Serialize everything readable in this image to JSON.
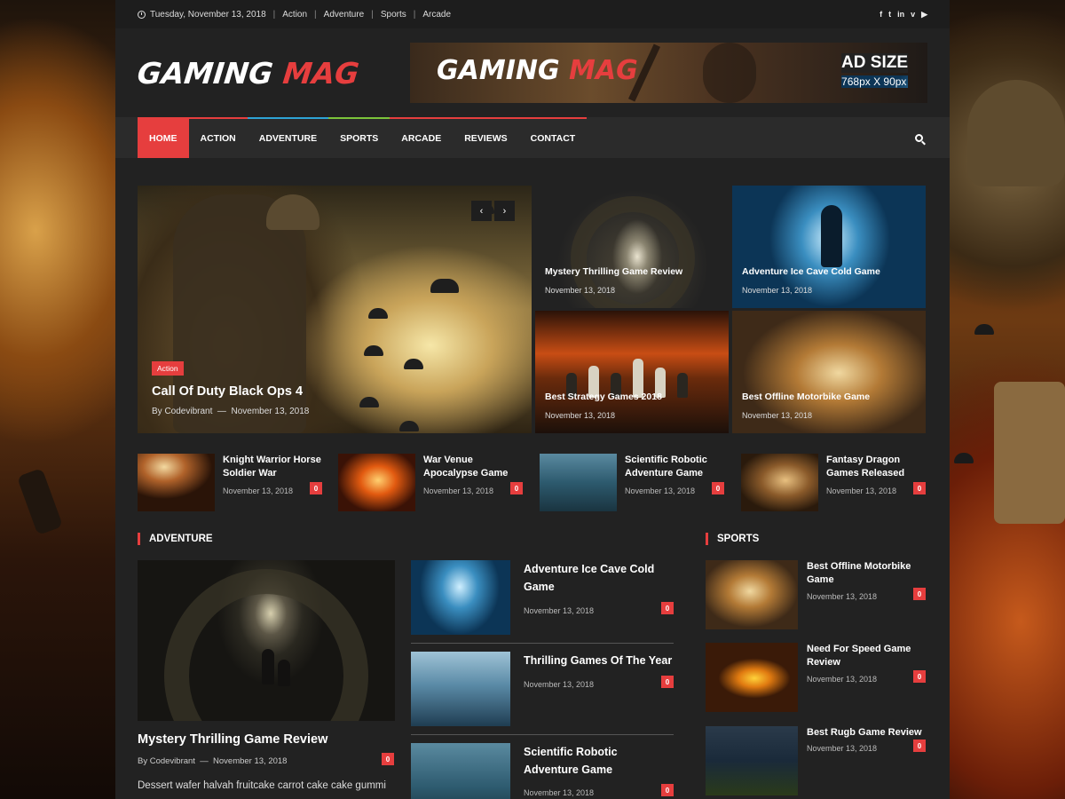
{
  "topbar": {
    "date": "Tuesday, November 13, 2018",
    "links": [
      "Action",
      "Adventure",
      "Sports",
      "Arcade"
    ],
    "social": [
      "facebook-icon",
      "twitter-icon",
      "linkedin-icon",
      "vimeo-icon",
      "youtube-icon"
    ],
    "social_glyphs": [
      "f",
      "t",
      "in",
      "v",
      "▶"
    ]
  },
  "header": {
    "logo_part1": "GAMING",
    "logo_part2": "MAG",
    "ad": {
      "logo_part1": "GAMING",
      "logo_part2": "MAG",
      "size_title": "AD SIZE",
      "size_dims": "768px X 90px"
    }
  },
  "nav": {
    "items": [
      {
        "label": "HOME",
        "color": "#e63e3e"
      },
      {
        "label": "ACTION",
        "color": "#e63e3e"
      },
      {
        "label": "ADVENTURE",
        "color": "#2ea3d6"
      },
      {
        "label": "SPORTS",
        "color": "#7cc43a"
      },
      {
        "label": "ARCADE",
        "color": "#e63e3e"
      },
      {
        "label": "REVIEWS",
        "color": "#e63e3e"
      },
      {
        "label": "CONTACT",
        "color": "#e63e3e"
      }
    ]
  },
  "featured": {
    "main": {
      "category": "Action",
      "title": "Call Of Duty Black Ops 4",
      "author": "By Codevibrant",
      "date": "November 13, 2018",
      "prev": "‹",
      "next": "›"
    },
    "tiles": [
      {
        "title": "Mystery Thrilling Game Review",
        "date": "November 13, 2018"
      },
      {
        "title": "Adventure Ice Cave Cold Game",
        "date": "November 13, 2018"
      },
      {
        "title": "Best Strategy Games 2018",
        "date": "November 13, 2018"
      },
      {
        "title": "Best Offline Motorbike Game",
        "date": "November 13, 2018"
      }
    ]
  },
  "small_posts": [
    {
      "title": "Knight Warrior Horse Soldier War",
      "date": "November 13, 2018",
      "comments": "0"
    },
    {
      "title": "War Venue Apocalypse Game",
      "date": "November 13, 2018",
      "comments": "0"
    },
    {
      "title": "Scientific Robotic Adventure Game",
      "date": "November 13, 2018",
      "comments": "0"
    },
    {
      "title": "Fantasy Dragon Games Released",
      "date": "November 13, 2018",
      "comments": "0"
    }
  ],
  "adventure": {
    "heading": "ADVENTURE",
    "main": {
      "title": "Mystery Thrilling Game Review",
      "author": "By Codevibrant",
      "date": "November 13, 2018",
      "comments": "0",
      "excerpt": "Dessert wafer halvah fruitcake carrot cake cake gummi"
    },
    "list": [
      {
        "title": "Adventure Ice Cave Cold Game",
        "date": "November 13, 2018",
        "comments": "0"
      },
      {
        "title": "Thrilling Games Of The Year",
        "date": "November 13, 2018",
        "comments": "0"
      },
      {
        "title": "Scientific Robotic Adventure Game",
        "date": "November 13, 2018",
        "comments": "0"
      }
    ]
  },
  "sports": {
    "heading": "SPORTS",
    "list": [
      {
        "title": "Best Offline Motorbike Game",
        "date": "November 13, 2018",
        "comments": "0"
      },
      {
        "title": "Need For Speed Game Review",
        "date": "November 13, 2018",
        "comments": "0"
      },
      {
        "title": "Best Rugb Game Review",
        "date": "November 13, 2018",
        "comments": "0"
      }
    ]
  },
  "colors": {
    "accent": "#e63e3e",
    "background": "#222222",
    "topbar": "#1d1d1d",
    "nav": "#2b2b2b"
  }
}
